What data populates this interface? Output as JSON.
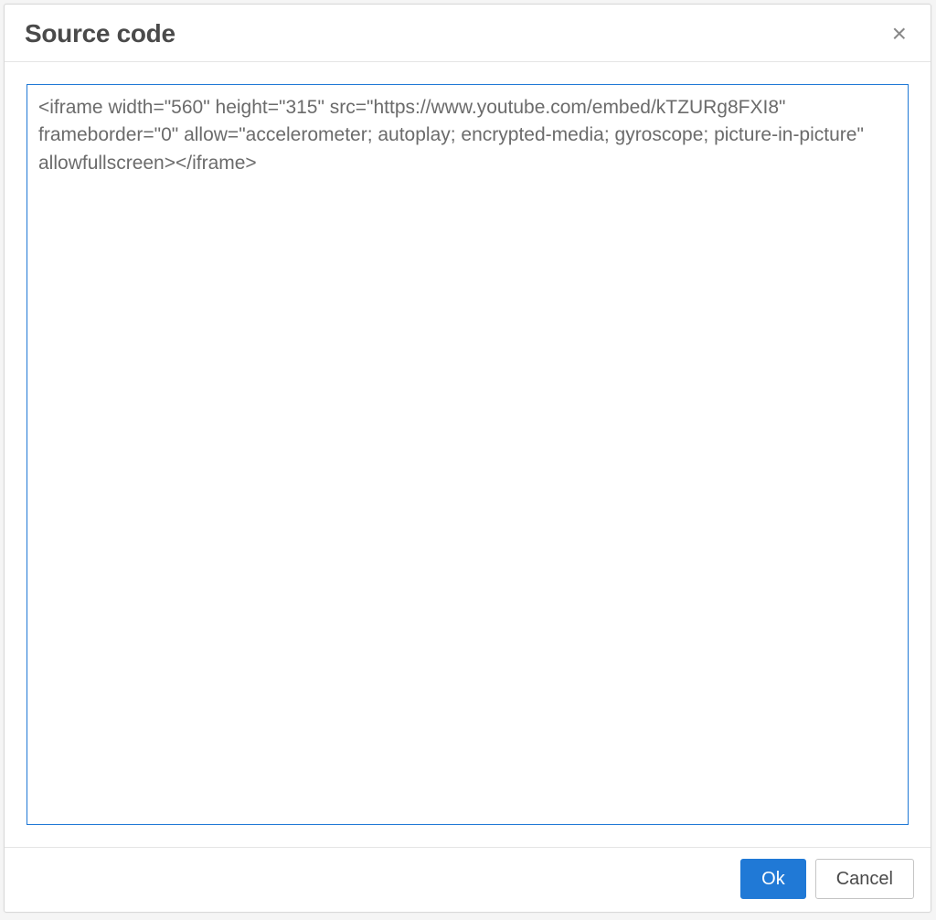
{
  "dialog": {
    "title": "Source code",
    "close_symbol": "×",
    "textarea_value": "<iframe width=\"560\" height=\"315\" src=\"https://www.youtube.com/embed/kTZURg8FXI8\" frameborder=\"0\" allow=\"accelerometer; autoplay; encrypted-media; gyroscope; picture-in-picture\" allowfullscreen></iframe>",
    "ok_label": "Ok",
    "cancel_label": "Cancel"
  }
}
